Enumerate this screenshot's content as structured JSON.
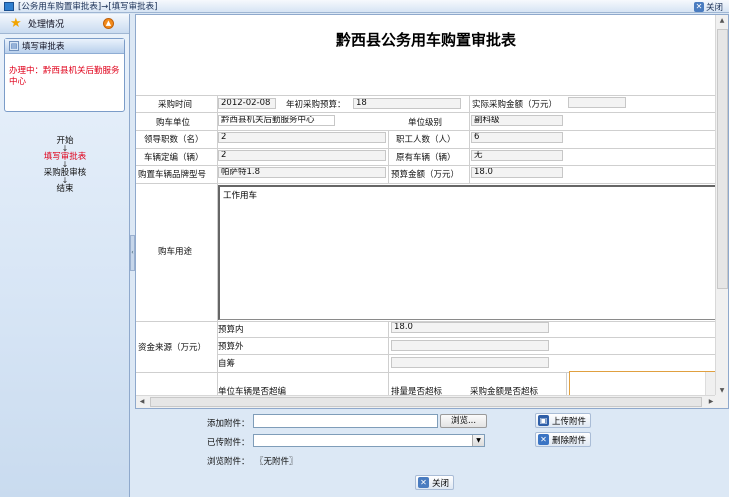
{
  "window": {
    "title": "[公务用车购置审批表]→[填写审批表]",
    "close_label": "关闭"
  },
  "sidebar": {
    "header": "处理情况",
    "card_title": "填写审批表",
    "status_text": "办理中：黔西县机关后勤服务中心",
    "flow": [
      "开始",
      "填写审批表",
      "采购股审核",
      "结束"
    ],
    "flow_arrow": "↓"
  },
  "form": {
    "title": "黔西县公务用车购置审批表",
    "purchase_time_label": "采购时间",
    "purchase_time": "2012-02-08",
    "annual_budget_label": "年初采购预算：",
    "annual_budget": "18",
    "actual_amount_label": "实际采购金额（万元）",
    "actual_amount": "",
    "unit_label": "购车单位",
    "unit": "黔西县机关后勤服务中心",
    "unit_level_label": "单位级别",
    "unit_level": "副科级",
    "leaders_label": "领导职数（名）",
    "leaders": "2",
    "staff_label": "职工人数（人）",
    "staff": "6",
    "vehicle_quota_label": "车辆定编（辆）",
    "vehicle_quota": "2",
    "existing_vehicles_label": "原有车辆（辆）",
    "existing_vehicles": "无",
    "model_label": "购置车辆品牌型号",
    "model": "帕萨特1.8",
    "budget_amount_label": "预算金额（万元）",
    "budget_amount": "18.0",
    "usage_label": "购车用途",
    "usage": "工作用车",
    "fund_source_label": "资金来源（万元）",
    "in_budget_label": "预算内",
    "in_budget": "18.0",
    "out_budget_label": "预算外",
    "out_budget": "",
    "self_raised_label": "自筹",
    "self_raised": "",
    "vehicle_over_label": "单位车辆是否超编",
    "displacement_over_label": "排量是否超标",
    "amount_over_label": "采购金额是否超标"
  },
  "attachments": {
    "add_label": "添加附件：",
    "browse_label": "浏览...",
    "uploaded_label": "已传附件：",
    "view_label": "浏览附件：",
    "view_value": "〖无附件〗",
    "upload_button": "上传附件",
    "delete_button": "删除附件",
    "close_button": "关闭"
  },
  "colors": {
    "accent_red": "#e0001a",
    "panel_blue": "#dce8f5"
  },
  "icons": [
    "app-icon",
    "close-icon",
    "star-icon",
    "collapse-icon",
    "card-icon",
    "save-icon",
    "delete-icon"
  ]
}
